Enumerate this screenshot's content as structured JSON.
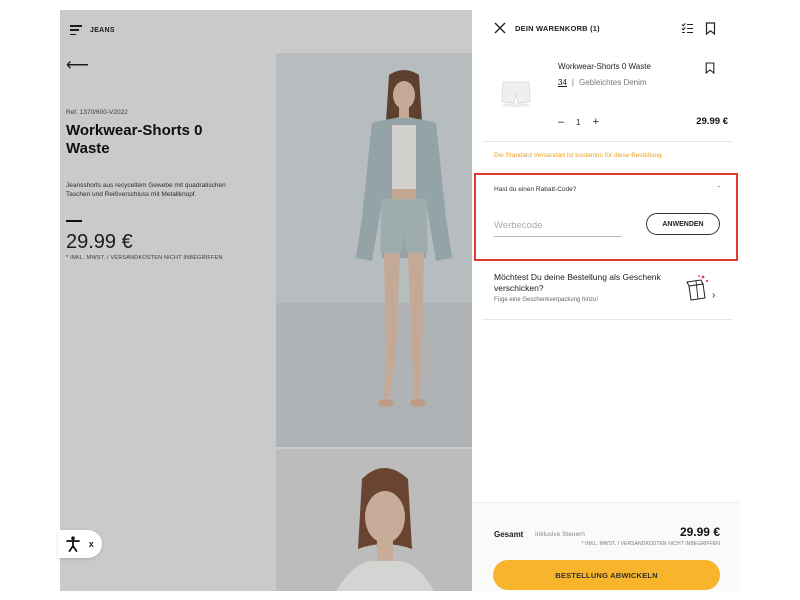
{
  "product_page": {
    "brand": "JEANS",
    "ref": "Ref. 1370/600-V2022",
    "title": "Workwear-Shorts 0 Waste",
    "description": "Jeansshorts aus recyceltem Gewebe mit quadratischen Taschen und Reißverschluss mit Metallknopf.",
    "price": "29.99 €",
    "tax_note": "* INKL. MWST. / VERSANDKOSTEN NICHT INBEGRIFFEN"
  },
  "accessibility_widget": {
    "close_label": "x"
  },
  "cart": {
    "title": "DEIN WARENKORB (1)",
    "items": [
      {
        "name": "Workwear-Shorts 0 Waste",
        "size": "34",
        "separator": "|",
        "color": "Gebleichtes Denim",
        "qty_minus": "–",
        "quantity": "1",
        "qty_plus": "+",
        "price": "29.99 €"
      }
    ],
    "shipping_note": "Die Standard Versandart ist kostenlos für diese Bestellung",
    "promo": {
      "label": "Hast du einen Rabatt-Code?",
      "toggle": "˗",
      "placeholder": "Werbecode",
      "apply_label": "ANWENDEN",
      "highlight_color": "#e03a2f"
    },
    "gift": {
      "title": "Möchtest Du deine Bestellung als Geschenk verschicken?",
      "subtitle": "Füge eine Geschenkverpackung hinzu!",
      "chevron": "›"
    },
    "footer": {
      "total_label": "Gesamt",
      "total_sub": "Inklusive Steuern",
      "total_price": "29.99 €",
      "tax_note": "* INKL. MWST. / VERSANDKOSTEN NICHT INBEGRIFFEN",
      "checkout_label": "BESTELLUNG ABWICKELN",
      "checkout_color": "#f8b42a"
    }
  },
  "icons": {
    "menu": "hamburger-icon",
    "back": "arrow-left-icon",
    "close": "close-icon",
    "list": "checklist-icon",
    "bookmark": "bookmark-icon",
    "gift": "gift-box-icon",
    "accessibility": "accessibility-icon"
  }
}
